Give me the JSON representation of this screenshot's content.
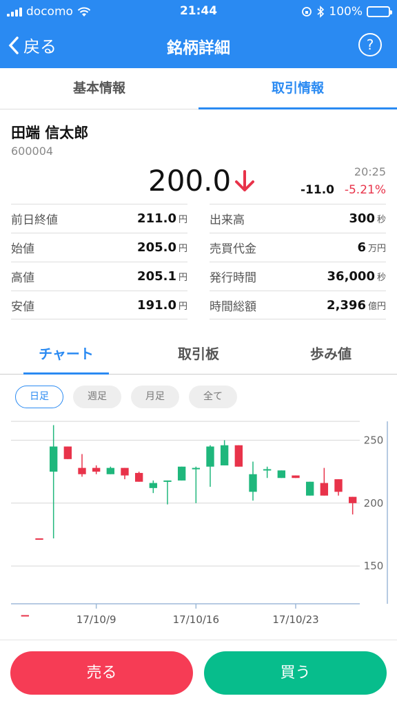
{
  "status": {
    "carrier": "docomo",
    "time": "21:44",
    "battery": "100%"
  },
  "nav": {
    "back_label": "戻る",
    "title": "銘柄詳細",
    "help_label": "?"
  },
  "tabs_top": [
    {
      "label": "基本情報",
      "active": false
    },
    {
      "label": "取引情報",
      "active": true
    }
  ],
  "stock": {
    "name": "田端 信太郎",
    "code": "600004",
    "price": "200.0",
    "time": "20:25",
    "change": "-11.0",
    "change_pct": "-5.21%"
  },
  "info_left": [
    {
      "key": "前日終値",
      "value": "211.0",
      "unit": "円"
    },
    {
      "key": "始値",
      "value": "205.0",
      "unit": "円"
    },
    {
      "key": "高値",
      "value": "205.1",
      "unit": "円"
    },
    {
      "key": "安値",
      "value": "191.0",
      "unit": "円"
    }
  ],
  "info_right": [
    {
      "key": "出来高",
      "value": "300",
      "unit": "秒"
    },
    {
      "key": "売買代金",
      "value": "6",
      "unit": "万円"
    },
    {
      "key": "発行時間",
      "value": "36,000",
      "unit": "秒"
    },
    {
      "key": "時間総額",
      "value": "2,396",
      "unit": "億円"
    }
  ],
  "tabs_chart": [
    {
      "label": "チャート",
      "active": true
    },
    {
      "label": "取引板",
      "active": false
    },
    {
      "label": "歩み値",
      "active": false
    }
  ],
  "periods": [
    {
      "label": "日足",
      "active": true
    },
    {
      "label": "週足",
      "active": false
    },
    {
      "label": "月足",
      "active": false
    },
    {
      "label": "全て",
      "active": false
    }
  ],
  "colors": {
    "accent": "#2a8af2",
    "up": "#1fb77c",
    "down": "#e8334a",
    "sell": "#f63c55",
    "buy": "#07bd8c"
  },
  "chart_data": {
    "type": "candlestick",
    "ylim": [
      120,
      265
    ],
    "y_ticks": [
      250,
      200,
      150
    ],
    "x_tick_labels": [
      {
        "label": "17/10/9",
        "index": 5
      },
      {
        "label": "17/10/16",
        "index": 12
      },
      {
        "label": "17/10/23",
        "index": 19
      }
    ],
    "candles": [
      {
        "o": 111,
        "h": 111,
        "l": 111,
        "c": 111
      },
      {
        "o": 172,
        "h": 172,
        "l": 172,
        "c": 172
      },
      {
        "o": 225,
        "h": 262,
        "l": 172,
        "c": 245
      },
      {
        "o": 245,
        "h": 245,
        "l": 235,
        "c": 235
      },
      {
        "o": 228,
        "h": 239,
        "l": 221,
        "c": 223
      },
      {
        "o": 228,
        "h": 230,
        "l": 223,
        "c": 225
      },
      {
        "o": 223,
        "h": 229,
        "l": 223,
        "c": 228
      },
      {
        "o": 228,
        "h": 228,
        "l": 219,
        "c": 222
      },
      {
        "o": 224,
        "h": 225,
        "l": 217,
        "c": 217
      },
      {
        "o": 212,
        "h": 218,
        "l": 208,
        "c": 216
      },
      {
        "o": 218,
        "h": 218,
        "l": 199,
        "c": 218
      },
      {
        "o": 218,
        "h": 229,
        "l": 218,
        "c": 229
      },
      {
        "o": 228,
        "h": 229,
        "l": 200,
        "c": 228
      },
      {
        "o": 229,
        "h": 246,
        "l": 213,
        "c": 245
      },
      {
        "o": 230,
        "h": 250,
        "l": 230,
        "c": 246
      },
      {
        "o": 246,
        "h": 246,
        "l": 229,
        "c": 229
      },
      {
        "o": 209,
        "h": 233,
        "l": 202,
        "c": 223
      },
      {
        "o": 227,
        "h": 229,
        "l": 220,
        "c": 227
      },
      {
        "o": 220,
        "h": 226,
        "l": 220,
        "c": 226
      },
      {
        "o": 222,
        "h": 222,
        "l": 220,
        "c": 220
      },
      {
        "o": 206,
        "h": 217,
        "l": 206,
        "c": 217
      },
      {
        "o": 216,
        "h": 228,
        "l": 206,
        "c": 206
      },
      {
        "o": 219,
        "h": 219,
        "l": 206,
        "c": 209
      },
      {
        "o": 205,
        "h": 205,
        "l": 191,
        "c": 200
      }
    ]
  },
  "actions": {
    "sell_label": "売る",
    "buy_label": "買う"
  }
}
